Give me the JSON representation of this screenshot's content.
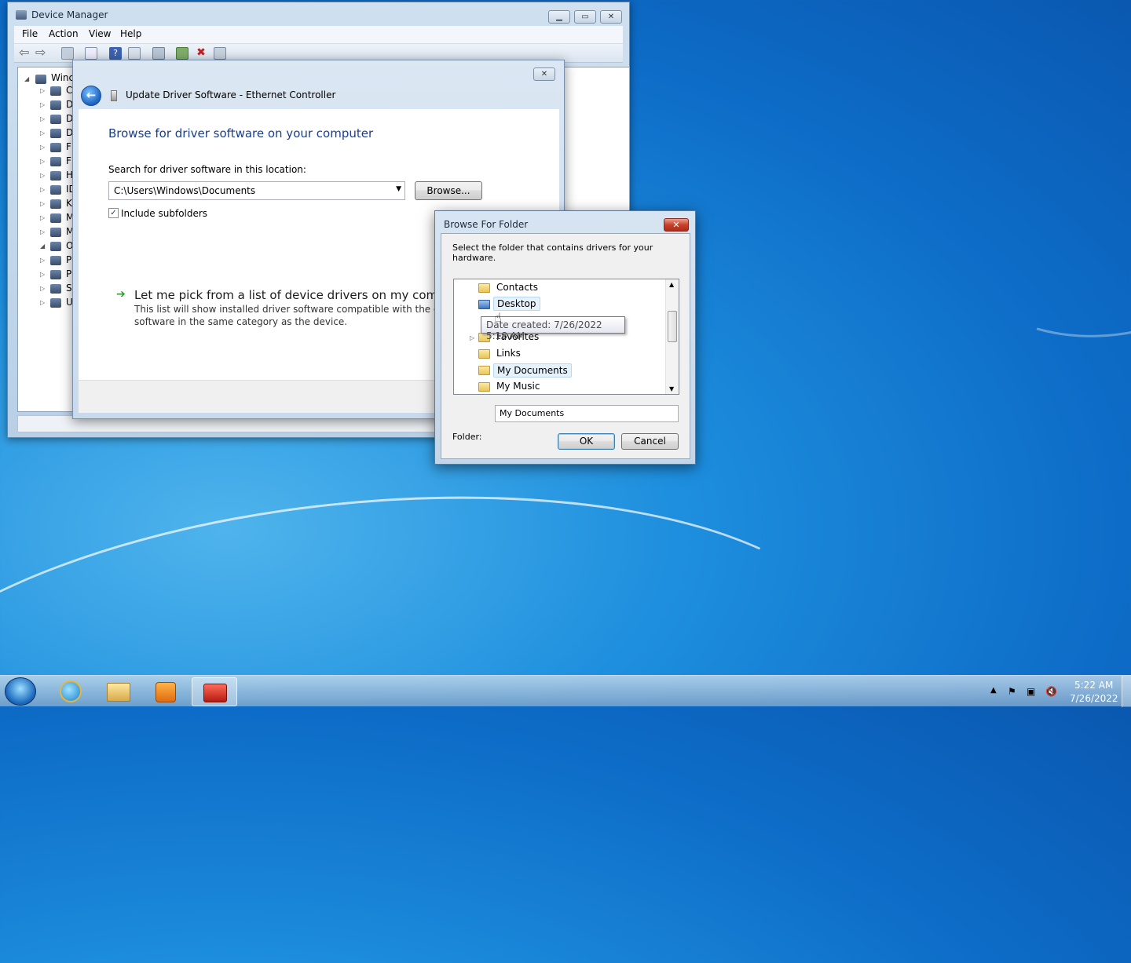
{
  "device_manager": {
    "title": "Device Manager",
    "menu": [
      "File",
      "Action",
      "View",
      "Help"
    ],
    "tree_root": "Winc",
    "tree_letters": [
      "C",
      "D",
      "D",
      "D",
      "F",
      "F",
      "H",
      "ID",
      "K",
      "M",
      "M",
      "O",
      "P",
      "P",
      "S",
      "U"
    ]
  },
  "wizard": {
    "title": "Update Driver Software - Ethernet Controller",
    "heading": "Browse for driver software on your computer",
    "search_label": "Search for driver software in this location:",
    "path_value": "C:\\Users\\Windows\\Documents",
    "browse_label": "Browse...",
    "include_subfolders": "Include subfolders",
    "pick_title": "Let me pick from a list of device drivers on my compute",
    "pick_desc_1": "This list will show installed driver software compatible with the device, ar",
    "pick_desc_2": "software in the same category as the device."
  },
  "browse_dialog": {
    "title": "Browse For Folder",
    "instruction": "Select the folder that contains drivers for your hardware.",
    "folders": [
      "Contacts",
      "Desktop",
      "Favorites",
      "Links",
      "My Documents",
      "My Music"
    ],
    "tooltip": "Date created: 7/26/2022 5:18 AM",
    "folder_label": "Folder:",
    "folder_value": "My Documents",
    "ok_label": "OK",
    "cancel_label": "Cancel"
  },
  "taskbar": {
    "time": "5:22 AM",
    "date": "7/26/2022"
  }
}
